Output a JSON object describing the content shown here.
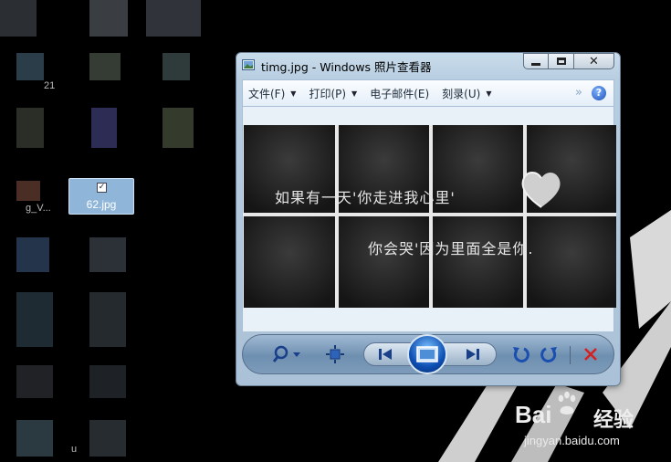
{
  "desktop": {
    "selected_file_label": "62.jpg",
    "partial_labels": [
      "21",
      "g_V...",
      "u"
    ]
  },
  "window": {
    "title": "timg.jpg - Windows 照片查看器",
    "icon": "photo-viewer-icon"
  },
  "menu": {
    "items": [
      {
        "label": "文件(F)",
        "has_dropdown": true
      },
      {
        "label": "打印(P)",
        "has_dropdown": true
      },
      {
        "label": "电子邮件(E)",
        "has_dropdown": false
      },
      {
        "label": "刻录(U)",
        "has_dropdown": true
      }
    ],
    "more_glyph": "»",
    "help_glyph": "?"
  },
  "photo": {
    "line1": "如果有一天'你走进我心里'",
    "line2": "你会哭'因为里面全是你."
  },
  "toolbar": {
    "icons": [
      "zoom-icon",
      "fit-window-icon",
      "previous-icon",
      "slideshow-icon",
      "next-icon",
      "rotate-left-icon",
      "rotate-right-icon",
      "delete-icon"
    ]
  },
  "watermark": {
    "brand": "Bai",
    "brand2": "经验",
    "url": "jingyan.baidu.com"
  },
  "colors": {
    "desktop_bg": "#000000",
    "frame": "#b7cde0",
    "nav_accent": "#0d4fb3",
    "delete_red": "#d62020"
  }
}
